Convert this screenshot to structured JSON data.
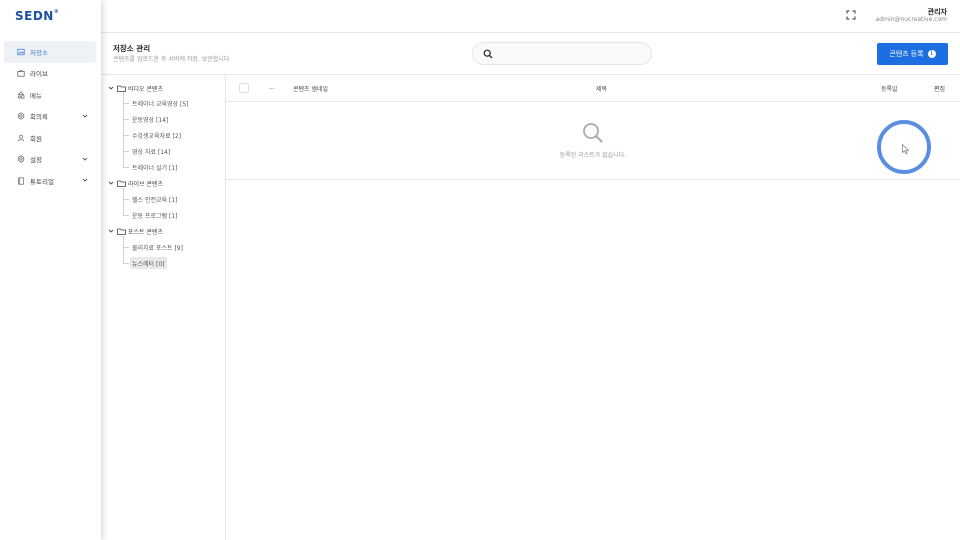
{
  "brand": {
    "logo": "SEDN"
  },
  "colors": {
    "accent": "#1c6fe0",
    "active_nav": "#3a7bd5",
    "ring": "#5b8de0"
  },
  "sidebar": {
    "items": [
      {
        "label": "저장소",
        "icon": "image-icon",
        "active": true,
        "has_chevron": false
      },
      {
        "label": "라이브",
        "icon": "live-tv-icon",
        "active": false,
        "has_chevron": false
      },
      {
        "label": "메뉴",
        "icon": "menu-shapes-icon",
        "active": false,
        "has_chevron": false
      },
      {
        "label": "회의록",
        "icon": "gear-hex-icon",
        "active": false,
        "has_chevron": true
      },
      {
        "label": "회원",
        "icon": "user-icon",
        "active": false,
        "has_chevron": false
      },
      {
        "label": "설정",
        "icon": "settings-icon",
        "active": false,
        "has_chevron": true
      },
      {
        "label": "튜토리얼",
        "icon": "book-icon",
        "active": false,
        "has_chevron": true
      }
    ]
  },
  "topbar": {
    "fullscreen_icon": "fullscreen-icon",
    "user_name": "관리자",
    "user_email": "admin@nucreative.com"
  },
  "header": {
    "title": "저장소 관리",
    "description": "콘텐츠를 업로드한 후 서버에 저장, 보관합니다",
    "search_placeholder": "",
    "register_button": "콘텐츠 등록"
  },
  "tree": {
    "folders": [
      {
        "label": "비디오 콘텐츠",
        "children": [
          "트레이너 교육영상 [5]",
          "운동영상 [14]",
          "수강생교육자료 [2]",
          "영상 자료 [14]",
          "트레이너 실기 [1]"
        ]
      },
      {
        "label": "라이브 콘텐츠",
        "children": [
          "헬스 안전교육 [1]",
          "운동 프로그램 [1]"
        ]
      },
      {
        "label": "포스트 콘텐츠",
        "children": [
          "물리치료 포스트 [9]",
          "뉴스레터 [0]"
        ]
      }
    ],
    "selected": "뉴스레터 [0]"
  },
  "table": {
    "columns": [
      "...",
      "콘텐츠 썸네일",
      "제목",
      "등록일",
      "편집"
    ],
    "empty_message": "등록된 리스트가 없습니다."
  }
}
